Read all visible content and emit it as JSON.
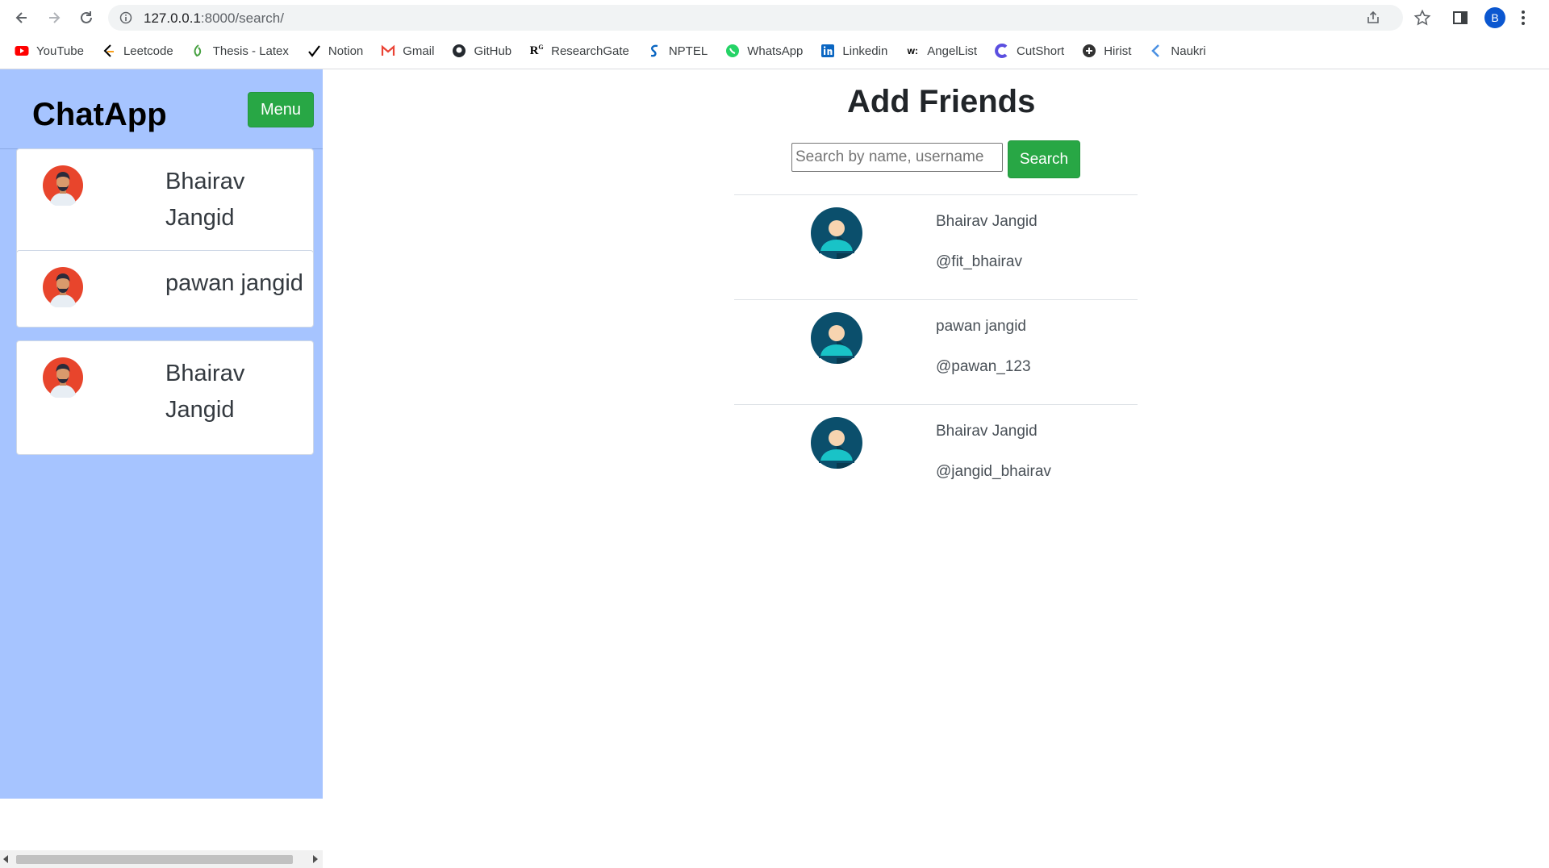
{
  "browser": {
    "url_host": "127.0.0.1",
    "url_path": ":8000/search/",
    "profile_initial": "B",
    "bookmarks": [
      {
        "label": "YouTube",
        "icon": "youtube-icon",
        "color": "#ff0000"
      },
      {
        "label": "Leetcode",
        "icon": "leetcode-icon",
        "color": "#f89f1b"
      },
      {
        "label": "Thesis - Latex",
        "icon": "overleaf-icon",
        "color": "#47a141"
      },
      {
        "label": "Notion",
        "icon": "notion-icon",
        "color": "#000000"
      },
      {
        "label": "Gmail",
        "icon": "gmail-icon",
        "color": "#ea4335"
      },
      {
        "label": "GitHub",
        "icon": "github-icon",
        "color": "#24292f"
      },
      {
        "label": "ResearchGate",
        "icon": "researchgate-icon",
        "color": "#000000"
      },
      {
        "label": "NPTEL",
        "icon": "nptel-icon",
        "color": "#0a66c2"
      },
      {
        "label": "WhatsApp",
        "icon": "whatsapp-icon",
        "color": "#25d366"
      },
      {
        "label": "Linkedin",
        "icon": "linkedin-icon",
        "color": "#0a66c2"
      },
      {
        "label": "AngelList",
        "icon": "angellist-icon",
        "color": "#000000"
      },
      {
        "label": "CutShort",
        "icon": "cutshort-icon",
        "color": "#5b4fe0"
      },
      {
        "label": "Hirist",
        "icon": "hirist-icon",
        "color": "#333333"
      },
      {
        "label": "Naukri",
        "icon": "naukri-icon",
        "color": "#4a90e2"
      }
    ]
  },
  "sidebar": {
    "brand": "ChatApp",
    "menu_label": "Menu",
    "chats": [
      {
        "name": "Bhairav Jangid"
      },
      {
        "name": "pawan jangid"
      },
      {
        "name": "Bhairav Jangid"
      }
    ]
  },
  "main": {
    "title": "Add Friends",
    "search_placeholder": "Search by name, username",
    "search_button": "Search",
    "results": [
      {
        "name": "Bhairav Jangid",
        "username": "@fit_bhairav"
      },
      {
        "name": "pawan jangid",
        "username": "@pawan_123"
      },
      {
        "name": "Bhairav Jangid",
        "username": "@jangid_bhairav"
      }
    ]
  },
  "colors": {
    "sidebar_bg": "#a6c4ff",
    "accent_green": "#28a745"
  }
}
